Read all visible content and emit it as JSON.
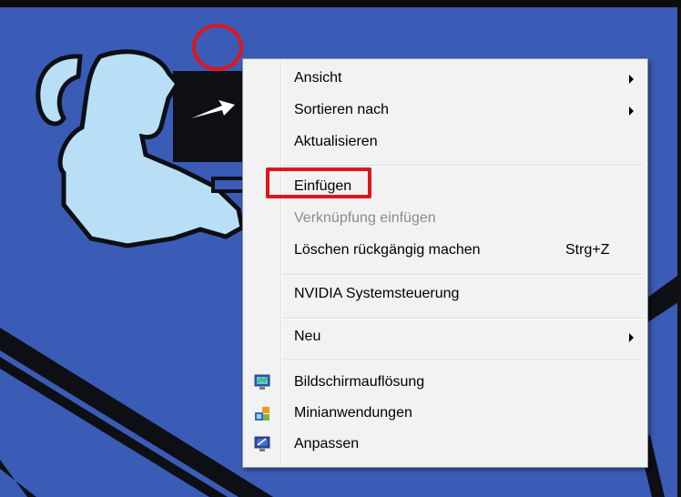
{
  "context_menu": {
    "items": [
      {
        "label": "Ansicht",
        "submenu": true
      },
      {
        "label": "Sortieren nach",
        "submenu": true
      },
      {
        "label": "Aktualisieren"
      },
      {
        "label": "Einfügen"
      },
      {
        "label": "Verknüpfung einfügen",
        "disabled": true
      },
      {
        "label": "Löschen rückgängig machen",
        "shortcut": "Strg+Z"
      },
      {
        "label": "NVIDIA Systemsteuerung"
      },
      {
        "label": "Neu",
        "submenu": true
      },
      {
        "label": "Bildschirmauflösung",
        "icon": "screen-resolution-icon"
      },
      {
        "label": "Minianwendungen",
        "icon": "gadgets-icon"
      },
      {
        "label": "Anpassen",
        "icon": "personalize-icon"
      }
    ]
  },
  "annotations": {
    "highlighted_item": "Einfügen",
    "color": "#e0151b"
  },
  "colors": {
    "desktop_background": "#3a5cb6",
    "menu_background": "#f2f2f2",
    "disabled_text": "#8c8c8c"
  }
}
